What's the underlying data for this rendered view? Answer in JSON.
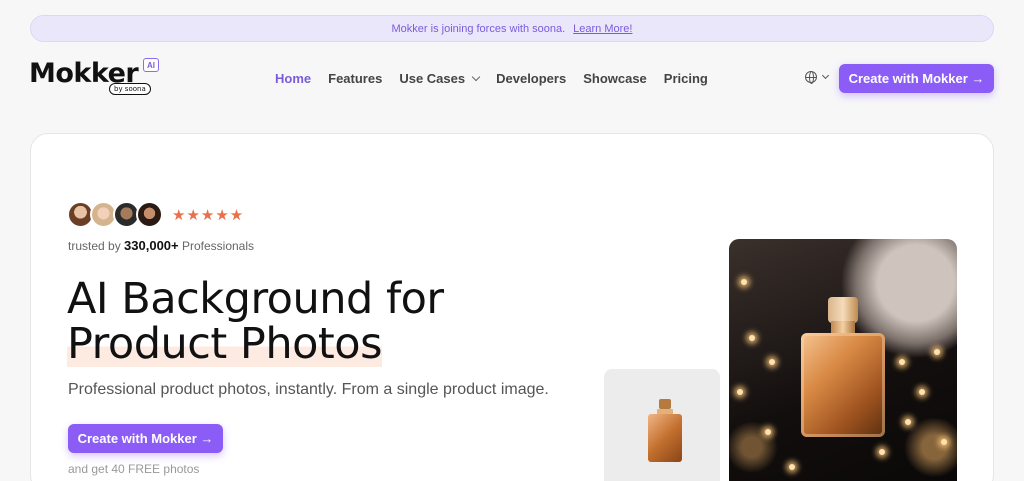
{
  "banner": {
    "text": "Mokker is joining forces with soona.",
    "link": "Learn More!"
  },
  "logo": {
    "word": "Mokker",
    "ai_badge": "AI",
    "by": "by soona"
  },
  "nav": {
    "items": [
      {
        "label": "Home"
      },
      {
        "label": "Features"
      },
      {
        "label": "Use Cases"
      },
      {
        "label": "Developers"
      },
      {
        "label": "Showcase"
      },
      {
        "label": "Pricing"
      }
    ]
  },
  "header": {
    "cta": "Create with Mokker →"
  },
  "hero": {
    "stars": "★★★★★",
    "trusted_prefix": "trusted by",
    "trusted_count": "330,000+",
    "trusted_suffix": "Professionals",
    "headline_line1": "AI Background for",
    "headline_line2": "Product Photos",
    "subtitle": "Professional product photos, instantly. From a single product image.",
    "cta": "Create with Mokker →",
    "free_note": "and get 40 FREE photos"
  },
  "colors": {
    "accent": "#8b5cf6",
    "star": "#e8704a",
    "banner_bg": "#ebe7fb"
  }
}
